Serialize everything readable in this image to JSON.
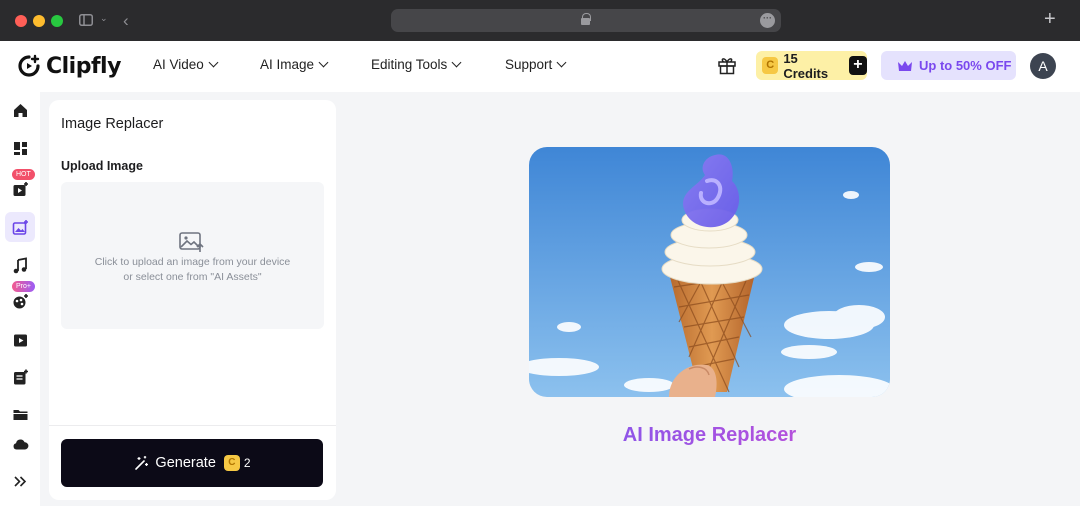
{
  "browser": {
    "url": ""
  },
  "header": {
    "logo_text": "Clipfly",
    "nav": [
      {
        "label": "AI Video"
      },
      {
        "label": "AI Image"
      },
      {
        "label": "Editing Tools"
      },
      {
        "label": "Support"
      }
    ],
    "credits_label": "15 Credits",
    "credits_coin": "C",
    "offer_label": "Up to 50% OFF",
    "avatar_initial": "A"
  },
  "sidebar": {
    "items": [
      {
        "icon": "home-icon"
      },
      {
        "icon": "templates-icon"
      },
      {
        "icon": "ai-video-icon",
        "badge": "HOT"
      },
      {
        "icon": "ai-image-icon",
        "active": true
      },
      {
        "icon": "music-icon"
      },
      {
        "icon": "effects-icon",
        "badge": "Pro+"
      },
      {
        "icon": "player-icon"
      },
      {
        "icon": "document-ai-icon"
      },
      {
        "icon": "folder-icon"
      },
      {
        "icon": "cloud-icon"
      },
      {
        "icon": "expand-icon"
      }
    ],
    "badges": {
      "hot": "HOT",
      "pro": "Pro+"
    }
  },
  "panel": {
    "title": "Image Replacer",
    "upload_label": "Upload Image",
    "upload_hint_line1": "Click to upload an image from your device",
    "upload_hint_line2": "or select one from \"AI Assets\"",
    "generate_label": "Generate",
    "generate_coin": "C",
    "generate_cost": "2"
  },
  "main": {
    "preview_title": "AI Image Replacer"
  },
  "colors": {
    "accent": "#7b56ee",
    "credits_bg": "#fdf0a6",
    "offer_bg": "#e5e2fd",
    "generate_bg": "#0c0a17"
  }
}
